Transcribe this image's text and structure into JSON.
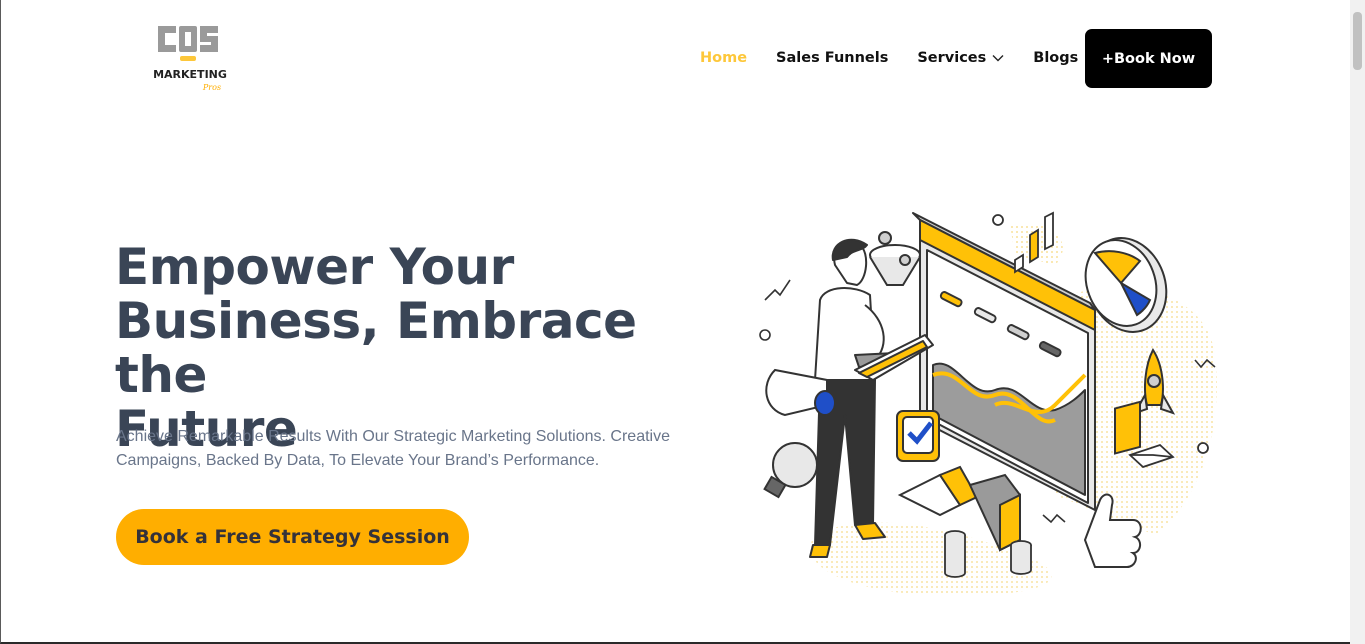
{
  "header": {
    "logo_text_top": "COS",
    "logo_text_mid": "MARKETING",
    "logo_text_script": "Pros",
    "nav": [
      {
        "label": "Home",
        "active": true
      },
      {
        "label": "Sales Funnels",
        "active": false
      },
      {
        "label": "Services",
        "active": false,
        "icon": "chevron-down-icon"
      },
      {
        "label": "Blogs",
        "active": false
      }
    ],
    "book_now_label": "+Book Now"
  },
  "hero": {
    "title_line1": "Empower Your",
    "title_line2": "Business, Embrace the",
    "title_line3": "Future",
    "subtitle_line1": "Achieve Remarkable Results With Our Strategic Marketing Solutions. Creative",
    "subtitle_line2": "Campaigns, Backed By Data, To Elevate Your Brand’s Performance.",
    "cta_label": "Book a Free Strategy Session"
  },
  "colors": {
    "accent": "#ffae00",
    "nav_active": "#fdc73a",
    "heading": "#3a4556",
    "body_text": "#69758a",
    "button_dark": "#000000"
  }
}
